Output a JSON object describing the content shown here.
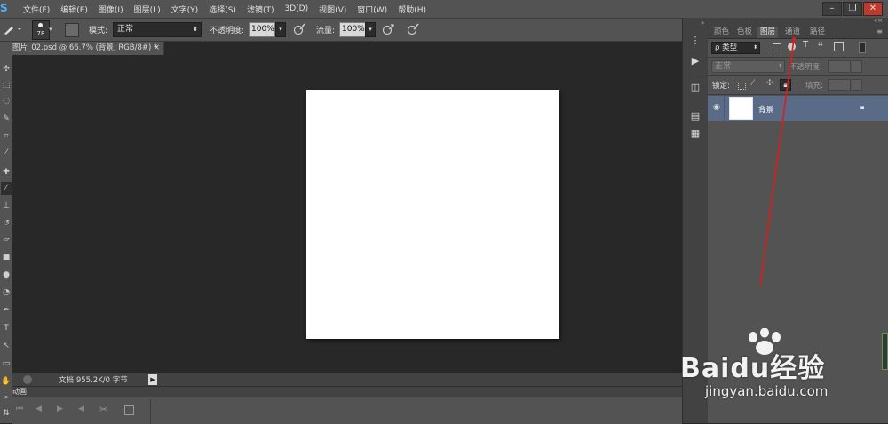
{
  "menubar": {
    "logo": "S",
    "items": [
      "文件(F)",
      "编辑(E)",
      "图像(I)",
      "图层(L)",
      "文字(Y)",
      "选择(S)",
      "滤镜(T)",
      "3D(D)",
      "视图(V)",
      "窗口(W)",
      "帮助(H)"
    ],
    "win_min": "–",
    "win_restore": "❐",
    "win_close": "✕"
  },
  "options": {
    "brush_size": "78",
    "mode_label": "模式:",
    "mode_value": "正常",
    "opacity_label": "不透明度:",
    "opacity_value": "100%",
    "flow_label": "流量:",
    "flow_value": "100%"
  },
  "document": {
    "tab_title": "图片_02.psd @ 66.7% (背景, RGB/8#) *",
    "tab_close": "×"
  },
  "status": {
    "doc_info": "文档:955.2K/0 字节"
  },
  "timeline": {
    "label": "动画"
  },
  "panel": {
    "tabs": [
      "颜色",
      "色板",
      "图层",
      "通道",
      "路径"
    ],
    "active_tab": "图层",
    "filter_kind": "ρ 类型",
    "blend_mode": "正常",
    "opacity_label": "不透明度:",
    "lock_label": "锁定:",
    "fill_label": "填充:",
    "layer_name": "背景",
    "selection_color": "#5a6b87",
    "annotation_color": "#e21a1a"
  },
  "watermark": {
    "text": "Baidu经验",
    "url": "jingyan.baidu.com"
  }
}
